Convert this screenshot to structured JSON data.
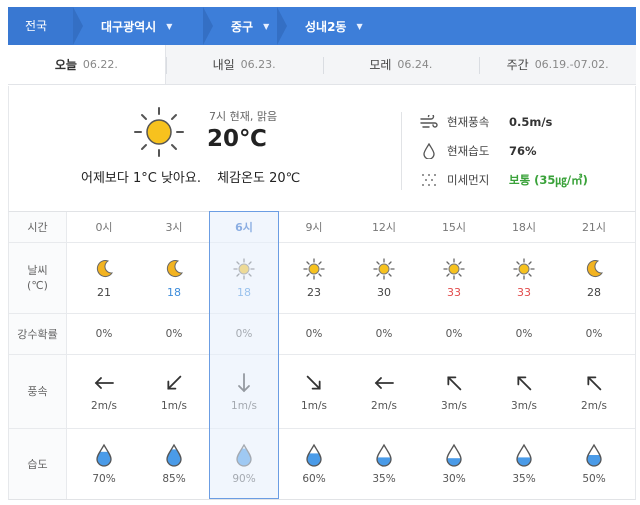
{
  "breadcrumb": {
    "root": "전국",
    "items": [
      {
        "label": "대구광역시"
      },
      {
        "label": "중구"
      },
      {
        "label": "성내2동"
      }
    ]
  },
  "tabs": [
    {
      "name": "오늘",
      "date": "06.22."
    },
    {
      "name": "내일",
      "date": "06.23."
    },
    {
      "name": "모레",
      "date": "06.24."
    },
    {
      "name": "주간",
      "date": "06.19.-07.02."
    }
  ],
  "current": {
    "desc": "7시 현재, 맑음",
    "temp": "20℃",
    "compare": "어제보다 1°C 낮아요.",
    "feel": "체감온도 20℃",
    "icon": "sun-icon"
  },
  "stats": [
    {
      "label": "현재풍속",
      "value": "0.5m/s",
      "icon": "wind-icon"
    },
    {
      "label": "현재습도",
      "value": "76%",
      "icon": "drop-icon"
    },
    {
      "label": "미세먼지",
      "value": "보통 (35㎍/㎥)",
      "icon": "dust-icon",
      "color": "#3aa23a"
    }
  ],
  "hourly": {
    "labels": {
      "time": "시간",
      "weather": "날씨\n(℃)",
      "precip": "강수확률",
      "wind": "풍속",
      "humidity": "습도"
    },
    "selected_index": 2,
    "hours": [
      {
        "time": "0시",
        "icon": "moon-icon",
        "temp": "21",
        "temp_style": "normal",
        "precip": "0%",
        "wind": "2m/s",
        "wind_dir": "arrow-left-icon",
        "humidity": "70%",
        "humidity_level": 0.7
      },
      {
        "time": "3시",
        "icon": "moon-icon",
        "temp": "18",
        "temp_style": "cold",
        "precip": "0%",
        "wind": "1m/s",
        "wind_dir": "arrow-down-left-icon",
        "humidity": "85%",
        "humidity_level": 0.85
      },
      {
        "time": "6시",
        "icon": "sun-icon",
        "temp": "18",
        "temp_style": "cold",
        "precip": "0%",
        "wind": "1m/s",
        "wind_dir": "arrow-down-icon",
        "humidity": "90%",
        "humidity_level": 0.9
      },
      {
        "time": "9시",
        "icon": "sun-icon",
        "temp": "23",
        "temp_style": "normal",
        "precip": "0%",
        "wind": "1m/s",
        "wind_dir": "arrow-down-right-icon",
        "humidity": "60%",
        "humidity_level": 0.6
      },
      {
        "time": "12시",
        "icon": "sun-icon",
        "temp": "30",
        "temp_style": "normal",
        "precip": "0%",
        "wind": "2m/s",
        "wind_dir": "arrow-left-icon",
        "humidity": "35%",
        "humidity_level": 0.35
      },
      {
        "time": "15시",
        "icon": "sun-icon",
        "temp": "33",
        "temp_style": "hot",
        "precip": "0%",
        "wind": "3m/s",
        "wind_dir": "arrow-up-left-icon",
        "humidity": "30%",
        "humidity_level": 0.3
      },
      {
        "time": "18시",
        "icon": "sun-icon",
        "temp": "33",
        "temp_style": "hot",
        "precip": "0%",
        "wind": "3m/s",
        "wind_dir": "arrow-up-left-icon",
        "humidity": "35%",
        "humidity_level": 0.35
      },
      {
        "time": "21시",
        "icon": "moon-icon",
        "temp": "28",
        "temp_style": "normal",
        "precip": "0%",
        "wind": "2m/s",
        "wind_dir": "arrow-up-left-icon",
        "humidity": "50%",
        "humidity_level": 0.5
      }
    ]
  },
  "colors": {
    "brand": "#3d7ed9",
    "hot": "#e24b4b",
    "cold": "#3e8ddb",
    "good": "#3aa23a",
    "sun": "#f7c21e",
    "moon": "#f2b321",
    "drop": "#4a9be8"
  }
}
